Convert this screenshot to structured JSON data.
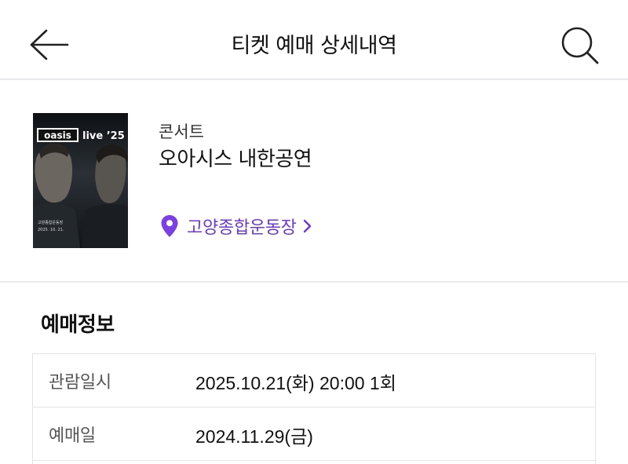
{
  "header": {
    "title": "티켓 예매 상세내역",
    "back_icon": "arrow-left-icon",
    "search_icon": "search-icon"
  },
  "event": {
    "category": "콘서트",
    "title": "오아시스 내한공연",
    "venue": "고양종합운동장",
    "venue_icon": "map-pin-icon",
    "accent_color": "#7b3fe4",
    "poster": {
      "brand": "oasis",
      "subtitle": "live ’25",
      "venue_text": "고양종합운동장",
      "date_text": "2025. 10. 21."
    }
  },
  "booking": {
    "section_title": "예매정보",
    "rows": [
      {
        "label": "관람일시",
        "value": "2025.10.21(화) 20:00 1회"
      },
      {
        "label": "예매일",
        "value": "2024.11.29(금)"
      }
    ]
  }
}
